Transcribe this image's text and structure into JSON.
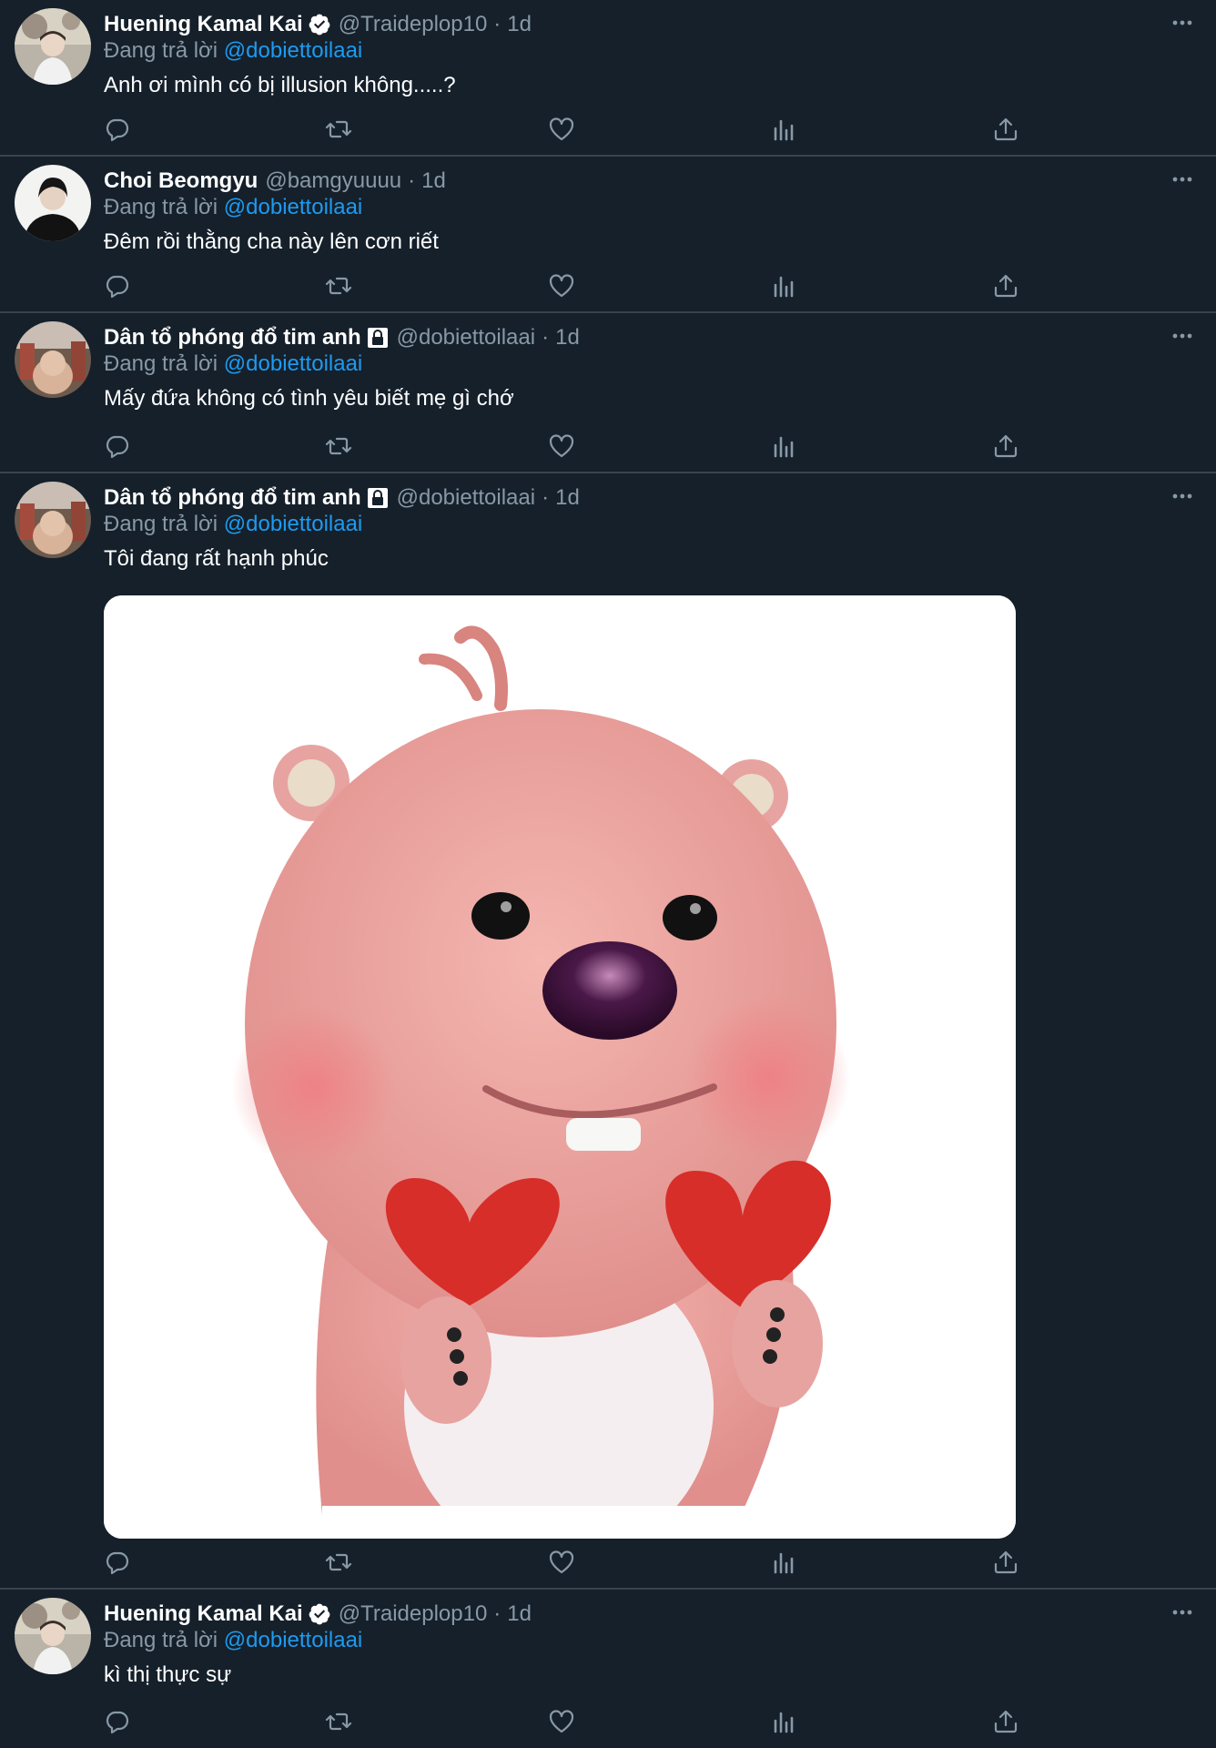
{
  "colors": {
    "background": "#15202b",
    "separator": "#38444d",
    "secondary_text": "#8899a6",
    "mention": "#1d9bf0",
    "primary_text": "#ffffff"
  },
  "reply_prefix": "Đang trả lời",
  "tweets": [
    {
      "name": "Huening Kamal Kai",
      "verified": true,
      "locked": false,
      "handle": "@Traideplop10",
      "dot": "·",
      "time": "1d",
      "reply_to": "@dobiettoilaai",
      "text": "Anh ơi mình có bị illusion không.....?",
      "avatar_icon": "user-avatar"
    },
    {
      "name": "Choi Beomgyu",
      "verified": false,
      "locked": false,
      "handle": "@bamgyuuuu",
      "dot": "·",
      "time": "1d",
      "reply_to": "@dobiettoilaai",
      "text": "Đêm rồi thằng cha này lên cơn riết",
      "avatar_icon": "user-avatar"
    },
    {
      "name": "Dân tổ phóng đổ tim anh",
      "verified": false,
      "locked": true,
      "handle": "@dobiettoilaai",
      "dot": "·",
      "time": "1d",
      "reply_to": "@dobiettoilaai",
      "text": "Mấy đứa không có tình yêu biết mẹ gì chớ",
      "avatar_icon": "user-avatar"
    },
    {
      "name": "Dân tổ phóng đổ tim anh",
      "verified": false,
      "locked": true,
      "handle": "@dobiettoilaai",
      "dot": "·",
      "time": "1d",
      "reply_to": "@dobiettoilaai",
      "text": "Tôi đang rất hạnh phúc",
      "avatar_icon": "user-avatar",
      "media": "pink-beaver-holding-hearts-image"
    },
    {
      "name": "Huening Kamal Kai",
      "verified": true,
      "locked": false,
      "handle": "@Traideplop10",
      "dot": "·",
      "time": "1d",
      "reply_to": "@dobiettoilaai",
      "text": "kì thị thực sự",
      "avatar_icon": "user-avatar"
    }
  ],
  "action_icons": [
    "reply-icon",
    "retweet-icon",
    "like-icon",
    "analytics-icon",
    "share-icon"
  ]
}
